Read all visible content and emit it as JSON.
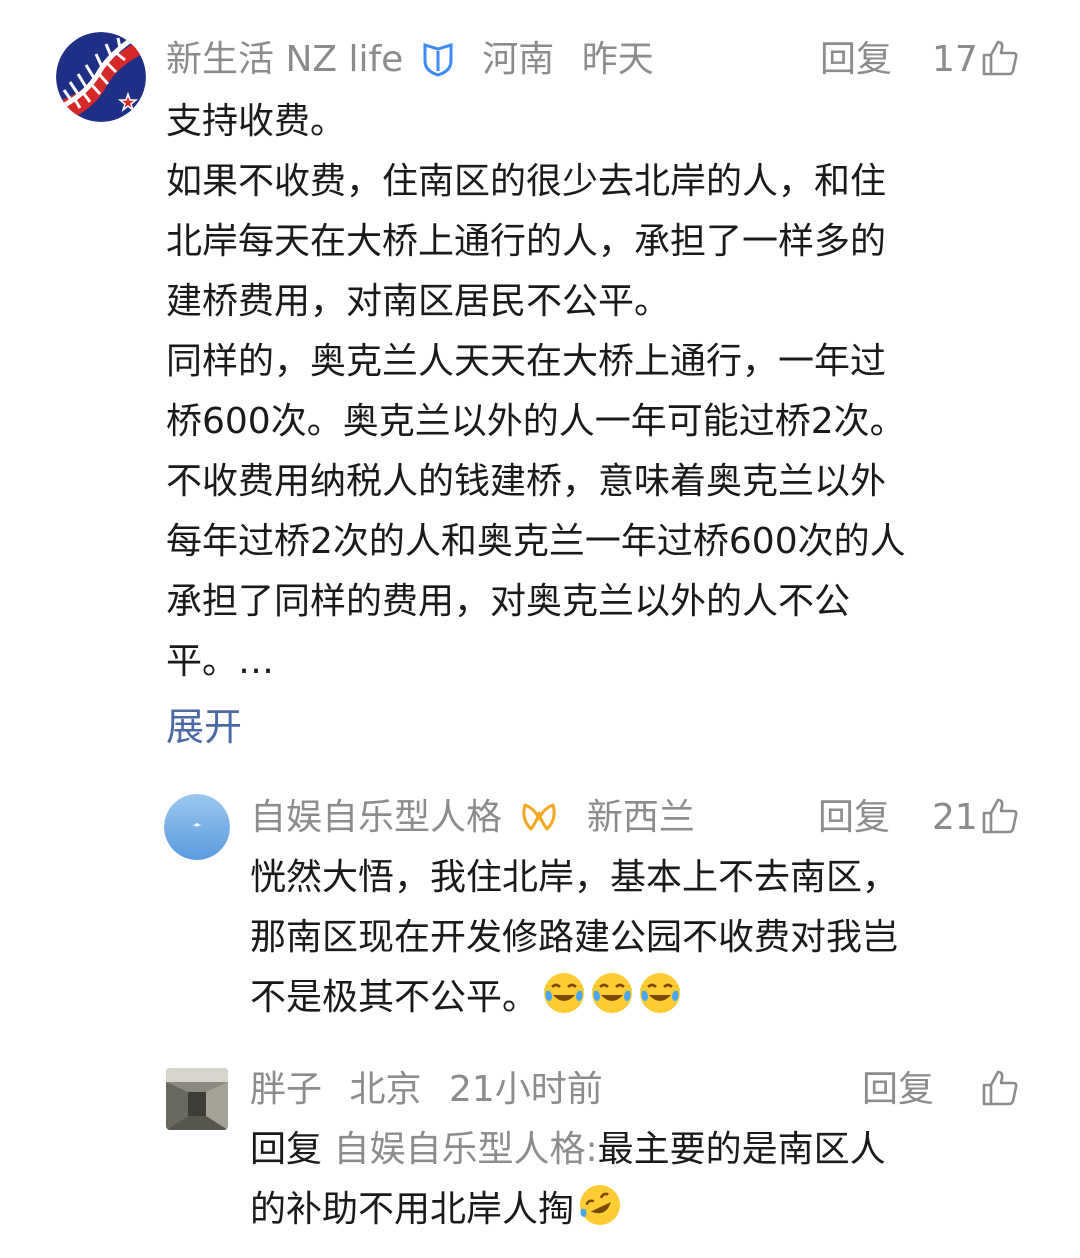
{
  "comments": [
    {
      "user": "新生活 NZ life",
      "verified": true,
      "location": "河南",
      "time": "昨天",
      "reply_label": "回复",
      "likes": "17",
      "lines": [
        "支持收费。",
        "如果不收费，住南区的很少去北岸的人，和住",
        "北岸每天在大桥上通行的人，承担了一样多的",
        "建桥费用，对南区居民不公平。",
        "同样的，奥克兰人天天在大桥上通行，一年过",
        "桥600次。奥克兰以外的人一年可能过桥2次。",
        "不收费用纳税人的钱建桥，意味着奥克兰以外",
        "每年过桥2次的人和奥克兰一年过桥600次的人",
        "承担了同样的费用，对奥克兰以外的人不公",
        "平。…"
      ],
      "expand_label": "展开",
      "replies": [
        {
          "user": "自娱自乐型人格",
          "location": "新西兰",
          "reply_label": "回复",
          "likes": "21",
          "lines": [
            "恍然大悟，我住北岸，基本上不去南区，",
            "那南区现在开发修路建公园不收费对我岂",
            "不是极其不公平。"
          ],
          "emojis": [
            "laugh-cry-emoji",
            "laugh-cry-emoji",
            "laugh-cry-emoji"
          ]
        },
        {
          "user": "胖子",
          "location": "北京",
          "time": "21小时前",
          "reply_label": "回复",
          "reply_prefix": "回复",
          "mention": "自娱自乐型人格:",
          "line1_rest": "最主要的是南区人",
          "line2": "的补助不用北岸人掏",
          "emojis": [
            "rofl-emoji"
          ]
        }
      ]
    }
  ],
  "colors": {
    "text": "#1a1a1a",
    "meta": "#8c8c8c",
    "link": "#4a6aa5",
    "verified_blue": "#3d8af7",
    "badge_orange": "#f5a623"
  }
}
